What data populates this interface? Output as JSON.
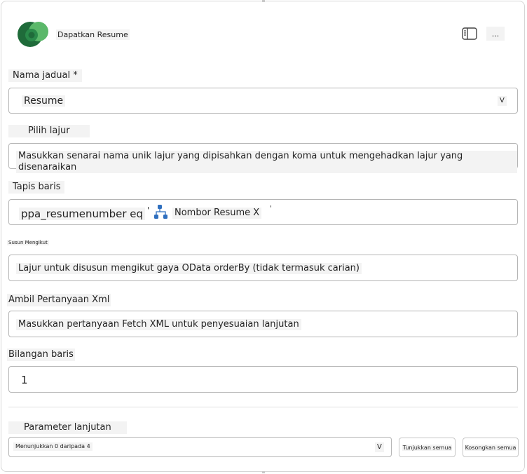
{
  "header": {
    "title": "Dapatkan Resume",
    "more_label": "..."
  },
  "fields": {
    "table_name": {
      "label": "Nama jadual *",
      "value": "Resume",
      "chevron": "V"
    },
    "select_columns": {
      "label": "Pilih lajur",
      "placeholder": "Masukkan senarai nama unik lajur yang dipisahkan dengan koma untuk mengehadkan lajur yang disenaraikan"
    },
    "filter_rows": {
      "label": "Tapis baris",
      "prefix": "ppa_resumenumber eq",
      "quote_open": "'",
      "token": "Nombor Resume X",
      "quote_close": "'"
    },
    "sort_by": {
      "label": "Susun Mengikut",
      "placeholder": "Lajur untuk disusun mengikut gaya OData orderBy (tidak termasuk carian)"
    },
    "fetch_xml": {
      "label": "Ambil Pertanyaan Xml",
      "placeholder": "Masukkan pertanyaan Fetch XML untuk penyesuaian lanjutan"
    },
    "row_count": {
      "label": "Bilangan baris",
      "value": "1"
    }
  },
  "advanced": {
    "label": "Parameter lanjutan",
    "dropdown_value": "Menunjukkan 0 daripada 4",
    "chevron": "V",
    "show_all": "Tunjukkan semua",
    "clear_all": "Kosongkan semua"
  },
  "colors": {
    "logo_dark": "#1f6b3a",
    "logo_light": "#5bb86a",
    "flow_icon": "#2f6fbf"
  }
}
